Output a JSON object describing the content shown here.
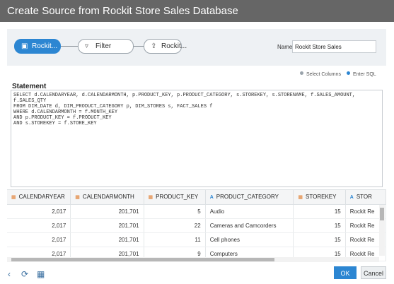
{
  "title": "Create Source from Rockit Store Sales Database",
  "steps": [
    {
      "label": "Rockit...",
      "icon": "database-icon",
      "active": true
    },
    {
      "label": "Filter",
      "icon": "filter-icon",
      "active": false
    },
    {
      "label": "Rockit...",
      "icon": "export-icon",
      "active": false
    }
  ],
  "name": {
    "label": "Name",
    "value": "Rockit Store Sales"
  },
  "statement": {
    "label": "Statement",
    "options": [
      "Select Columns",
      "Enter SQL"
    ],
    "selected": "Enter SQL",
    "lines": [
      "SELECT d.CALENDARYEAR, d.CALENDARMONTH, p.PRODUCT_KEY, p.PRODUCT_CATEGORY, s.STOREKEY, s.STORENAME, f.SALES_AMOUNT,",
      "f.SALES_QTY",
      "FROM DIM_DATE d, DIM_PRODUCT_CATEGORY p, DIM_STORES s, FACT_SALES f",
      "WHERE d.CALENDARMONTH = f.MONTH_KEY",
      "AND p.PRODUCT_KEY = f.PRODUCT_KEY",
      "AND s.STOREKEY = f.STORE_KEY"
    ]
  },
  "table": {
    "columns": [
      {
        "name": "CALENDARYEAR",
        "type": "number"
      },
      {
        "name": "CALENDARMONTH",
        "type": "number"
      },
      {
        "name": "PRODUCT_KEY",
        "type": "number"
      },
      {
        "name": "PRODUCT_CATEGORY",
        "type": "text"
      },
      {
        "name": "STOREKEY",
        "type": "number"
      },
      {
        "name": "STOR",
        "type": "text"
      }
    ],
    "rows": [
      [
        "2,017",
        "201,701",
        "5",
        "Audio",
        "15",
        "Rockit Re"
      ],
      [
        "2,017",
        "201,701",
        "22",
        "Cameras and Camcorders",
        "15",
        "Rockit Re"
      ],
      [
        "2,017",
        "201,701",
        "11",
        "Cell phones",
        "15",
        "Rockit Re"
      ],
      [
        "2,017",
        "201,701",
        "9",
        "Computers",
        "15",
        "Rockit Re"
      ]
    ]
  },
  "footer": {
    "ok": "OK",
    "cancel": "Cancel"
  },
  "colors": {
    "accent": "#2c86d2",
    "titlebar": "#666666",
    "number_icon": "#e07a2a"
  }
}
